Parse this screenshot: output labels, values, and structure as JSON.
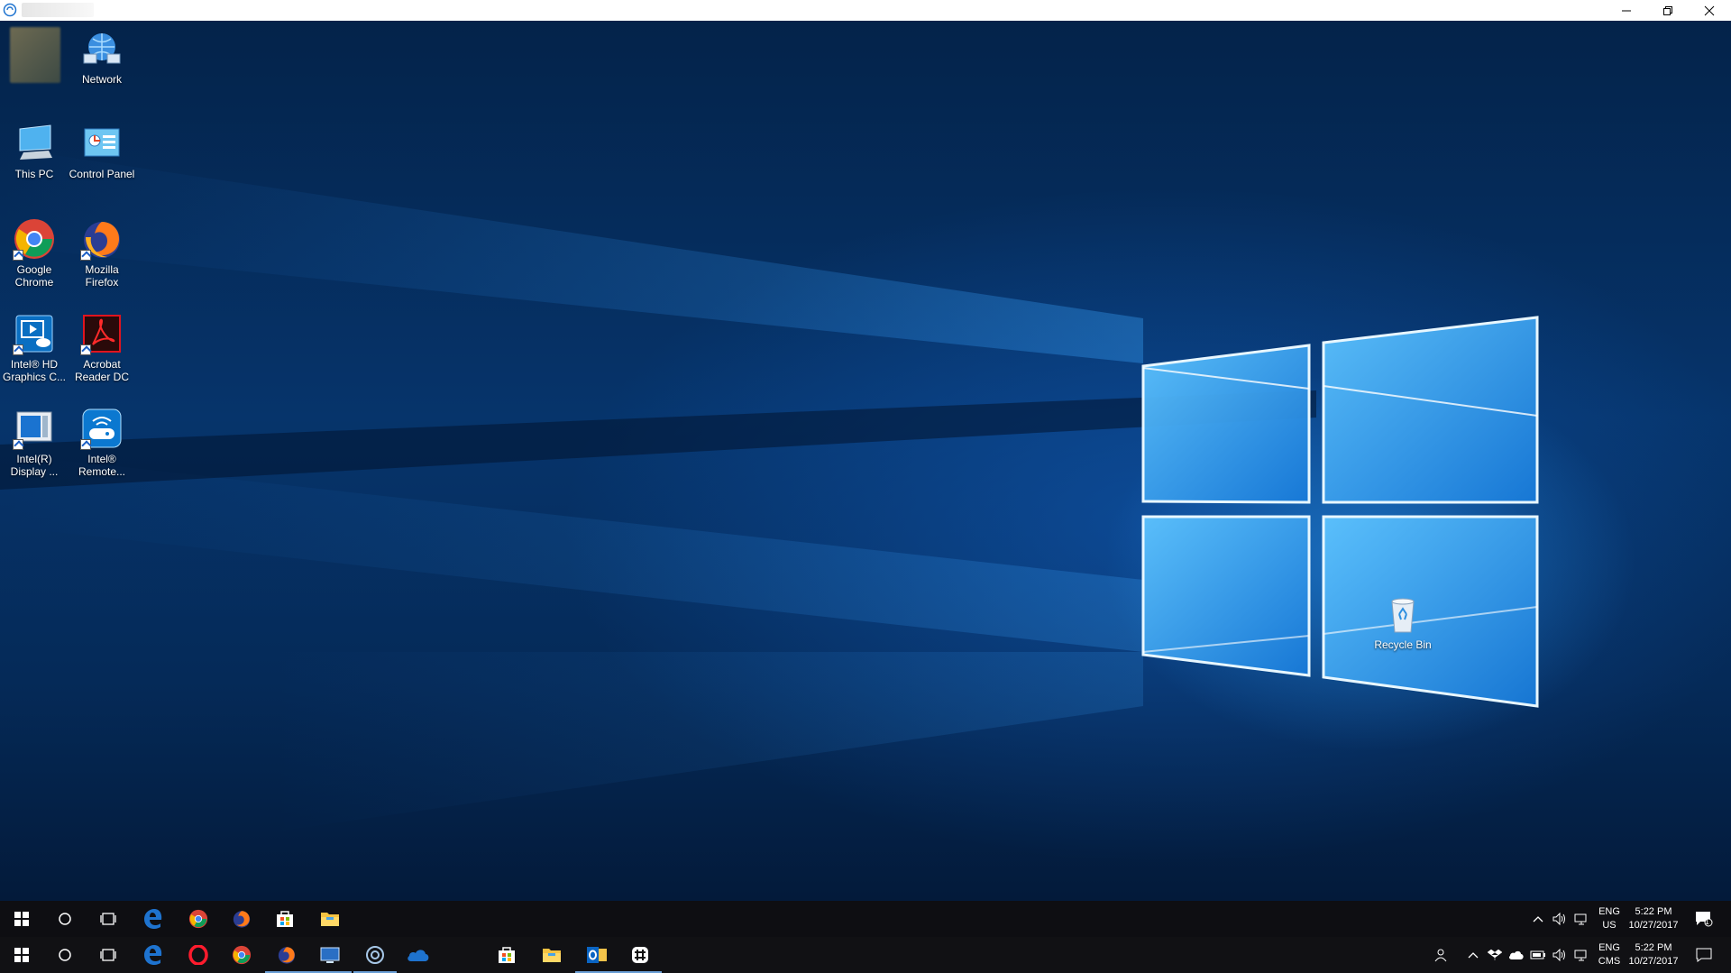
{
  "window": {
    "controls": [
      "minimize",
      "restore",
      "close"
    ]
  },
  "desktop_icons": {
    "network": "Network",
    "this_pc": "This PC",
    "control_panel": "Control Panel",
    "chrome": "Google Chrome",
    "firefox": "Mozilla Firefox",
    "intel_graphics": "Intel® HD Graphics C...",
    "acrobat": "Acrobat Reader DC",
    "intel_display": "Intel(R) Display ...",
    "intel_remote": "Intel® Remote...",
    "recycle_bin": "Recycle Bin"
  },
  "taskbar_top": {
    "pinned": [
      "start-icon",
      "search-icon",
      "task-view-icon",
      "edge-icon",
      "chrome-icon",
      "firefox-icon",
      "store-icon",
      "file-explorer-icon"
    ],
    "lang_line1": "ENG",
    "lang_line2": "US",
    "time": "5:22 PM",
    "date": "10/27/2017",
    "notification_count": "1"
  },
  "taskbar_bottom": {
    "pinned": [
      "start-icon",
      "search-icon",
      "task-view-icon",
      "edge-icon",
      "opera-icon",
      "chrome-icon",
      "firefox-icon",
      "remote-desktop-icon",
      "settings-icon",
      "onedrive-icon",
      "store-icon",
      "file-explorer-icon",
      "outlook-icon",
      "slack-icon"
    ],
    "lang_line1": "ENG",
    "lang_line2": "CMS",
    "time": "5:22 PM",
    "date": "10/27/2017"
  },
  "colors": {
    "wallpaper_dark": "#04234a",
    "wallpaper_glow": "#2896f0",
    "taskbar": "#0e0e12",
    "edge_blue": "#1e73cf"
  }
}
